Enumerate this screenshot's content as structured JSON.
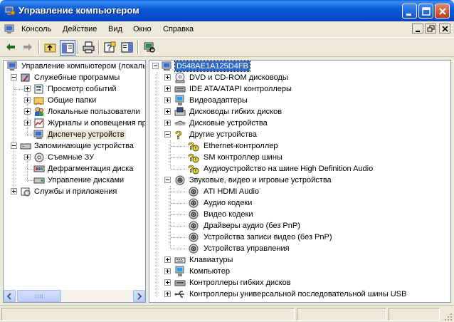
{
  "window": {
    "title": "Управление компьютером",
    "title_icon": "computer-management-icon",
    "controls": [
      "minimize-icon",
      "maximize-icon",
      "close-icon"
    ]
  },
  "menu": {
    "items": [
      {
        "label": "Консоль"
      },
      {
        "label": "Действие"
      },
      {
        "label": "Вид"
      },
      {
        "label": "Окно"
      },
      {
        "label": "Справка"
      }
    ]
  },
  "toolbar": {
    "buttons": [
      "back-arrow-icon",
      "forward-arrow-icon",
      "up-folder-icon",
      "show-hide-tree-icon",
      "print-icon",
      "help-icon",
      "show-hide-action-pane-icon",
      "scan-hardware-icon"
    ]
  },
  "left_tree": {
    "items": [
      {
        "label": "Управление компьютером (локаль",
        "icon": "computer-management-icon"
      },
      {
        "label": "Служебные программы",
        "icon": "tools-icon"
      },
      {
        "label": "Просмотр событий",
        "icon": "event-viewer-icon"
      },
      {
        "label": "Общие папки",
        "icon": "shared-folders-icon"
      },
      {
        "label": "Локальные пользователи",
        "icon": "users-icon"
      },
      {
        "label": "Журналы и оповещения пр",
        "icon": "performance-logs-icon"
      },
      {
        "label": "Диспетчер устройств",
        "icon": "device-manager-icon"
      },
      {
        "label": "Запоминающие устройства",
        "icon": "storage-icon"
      },
      {
        "label": "Съемные ЗУ",
        "icon": "removable-storage-icon"
      },
      {
        "label": "Дефрагментация диска",
        "icon": "defrag-icon"
      },
      {
        "label": "Управление дисками",
        "icon": "disk-management-icon"
      },
      {
        "label": "Службы и приложения",
        "icon": "services-icon"
      }
    ]
  },
  "right_tree": {
    "root": {
      "label": "D548AE1A125D4FB",
      "icon": "computer-icon"
    },
    "items": [
      {
        "label": "DVD и CD-ROM дисководы",
        "icon": "cdrom-icon"
      },
      {
        "label": "IDE ATA/ATAPI контроллеры",
        "icon": "ide-controller-icon"
      },
      {
        "label": "Видеоадаптеры",
        "icon": "display-adapter-icon"
      },
      {
        "label": "Дисководы гибких дисков",
        "icon": "floppy-drive-icon"
      },
      {
        "label": "Дисковые устройства",
        "icon": "disk-drive-icon"
      },
      {
        "label": "Другие устройства",
        "icon": "unknown-device-icon"
      },
      {
        "label": "Ethernet-контроллер",
        "icon": "unknown-device-warning-icon"
      },
      {
        "label": "SM контроллер шины",
        "icon": "unknown-device-warning-icon"
      },
      {
        "label": "Аудиоустройство на шине High Definition Audio",
        "icon": "unknown-device-warning-icon"
      },
      {
        "label": "Звуковые, видео и игровые устройства",
        "icon": "sound-device-icon"
      },
      {
        "label": "ATI HDMI Audio",
        "icon": "sound-device-icon"
      },
      {
        "label": "Аудио кодеки",
        "icon": "sound-device-icon"
      },
      {
        "label": "Видео кодеки",
        "icon": "sound-device-icon"
      },
      {
        "label": "Драйверы аудио (без PnP)",
        "icon": "sound-device-icon"
      },
      {
        "label": "Устройства записи видео (без PnP)",
        "icon": "sound-device-icon"
      },
      {
        "label": "Устройства управления",
        "icon": "sound-device-icon"
      },
      {
        "label": "Клавиатуры",
        "icon": "keyboard-icon"
      },
      {
        "label": "Компьютер",
        "icon": "computer-icon"
      },
      {
        "label": "Контроллеры гибких дисков",
        "icon": "floppy-controller-icon"
      },
      {
        "label": "Контроллеры универсальной последовательной шины USB",
        "icon": "usb-icon"
      }
    ]
  }
}
